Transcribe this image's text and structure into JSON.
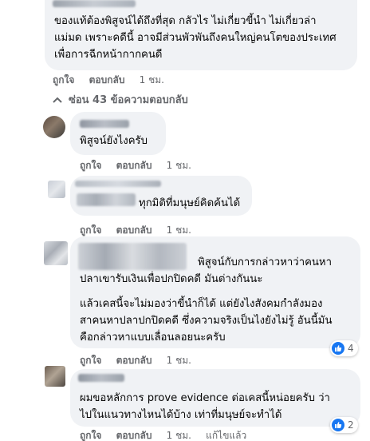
{
  "comments": [
    {
      "lines": [
        "ของแท้ต้องพิสูจน์ได้ถึงที่สุด กลัวไร ไม่เกี่ยวขี้นำ ไม่เกี่ยวล่า",
        "แม่มด เพราะคดีนี้ อาจมีส่วนพัวพันถึงคนใหญ่คนโตของประเทศ",
        "เพื่อการฉีกหน้ากากคนดี"
      ],
      "like": "ถูกใจ",
      "reply": "ตอบกลับ",
      "time": "1 ชม."
    },
    {
      "lines": [
        "พิสูจน์ยังไงครับ"
      ],
      "like": "ถูกใจ",
      "reply": "ตอบกลับ",
      "time": "1 ชม."
    },
    {
      "lines": [
        "ทุกมิติที่มนุษย์คิดค้นได้"
      ],
      "like": "ถูกใจ",
      "reply": "ตอบกลับ",
      "time": "1 ชม."
    },
    {
      "lines": [
        "พิสูจน์กับการกล่าวหาว่าคนหา",
        "ปลาเขารับเงินเพื่อปกปิดคดี มันต่างกันนะ",
        "แล้วเคสนี้จะไม่มองว่าขี้นำก็ได้ แต่ยังไงสังคมกำลังมอง",
        "สาคนหาปลาปกปิดคดี ซึ่งความจริงเป็นไงยังไม่รู้ อันนี้มัน",
        "คือกล่าวหาแบบเลื่อนลอยนะครับ"
      ],
      "like": "ถูกใจ",
      "reply": "ตอบกลับ",
      "time": "1 ชม.",
      "reaction_count": "4"
    },
    {
      "lines": [
        "ผมขอหลักการ prove evidence ต่อเคสนี้หน่อยครับ ว่า",
        "ไปในแนวทางไหนได้บ้าง เท่าที่มนุษย์จะทำได้"
      ],
      "like": "ถูกใจ",
      "reply": "ตอบกลับ",
      "time": "1 ชม.",
      "edited": "แก้ไขแล้ว",
      "reaction_count": "2"
    }
  ],
  "collapse_label": "ซ่อน 43 ข้อความตอบกลับ",
  "colors": {
    "bubble": "#f0f2f5",
    "meta": "#65676b",
    "like_blue": "#1877f2"
  },
  "icons": [
    "chevron-up-icon",
    "like-reaction-icon"
  ]
}
